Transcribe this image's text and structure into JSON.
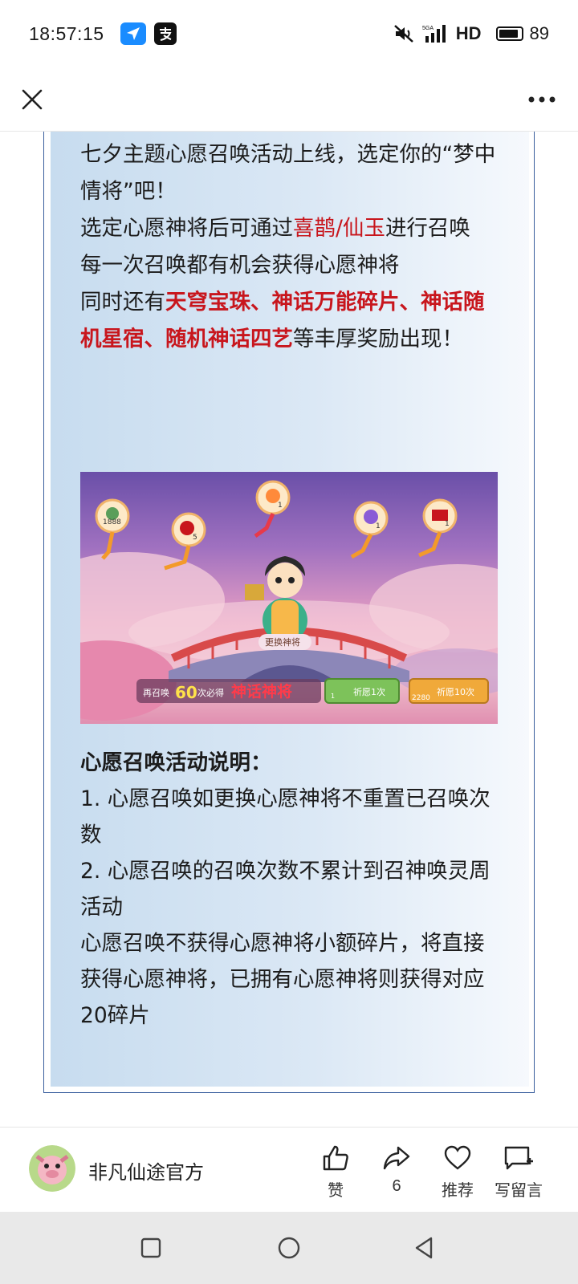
{
  "status": {
    "time": "18:57:15",
    "network": "HD",
    "battery": "89",
    "battery_level": 0.89,
    "signal_label": "5GA"
  },
  "nav": {
    "close_icon": "close-icon",
    "more_icon": "more-icon"
  },
  "article": {
    "p1": "七夕主题心愿召唤活动上线，选定你的“梦中情将”吧！",
    "p2_pre": "选定心愿神将后可通过",
    "p2_red": "喜鹊/仙玉",
    "p2_post": "进行召唤",
    "p3": "每一次召唤都有机会获得心愿神将",
    "p4_pre": "同时还有",
    "p4_red": "天穹宝珠、神话万能碎片、神话随机星宿、随机神话四艺",
    "p4_post": "等丰厚奖励出现！",
    "banner": {
      "reward_counts": [
        "1888",
        "5",
        "1",
        "1",
        "1"
      ],
      "change_button": "更换神将",
      "summon_prefix": "再召唤",
      "summon_count": "60",
      "summon_suffix": "次必得",
      "mythic": "神话神将",
      "wish_once": "祈愿1次",
      "wish_once_cost": "1",
      "wish_ten": "祈愿10次",
      "wish_ten_cost": "2280"
    },
    "notes_heading": "心愿召唤活动说明：",
    "note1": "1. 心愿召唤如更换心愿神将不重置已召唤次数",
    "note2": "2. 心愿召唤的召唤次数不累计到召神唤灵周活动",
    "note3": "心愿召唤不获得心愿神将小额碎片，将直接获得心愿神将，已拥有心愿神将则获得对应20碎片"
  },
  "footer": {
    "account_name": "非凡仙途官方",
    "like_label": "赞",
    "share_count": "6",
    "recommend_label": "推荐",
    "comment_label": "写留言"
  },
  "colors": {
    "accent_red": "#c8161d",
    "card_border": "#3b5f9e"
  }
}
